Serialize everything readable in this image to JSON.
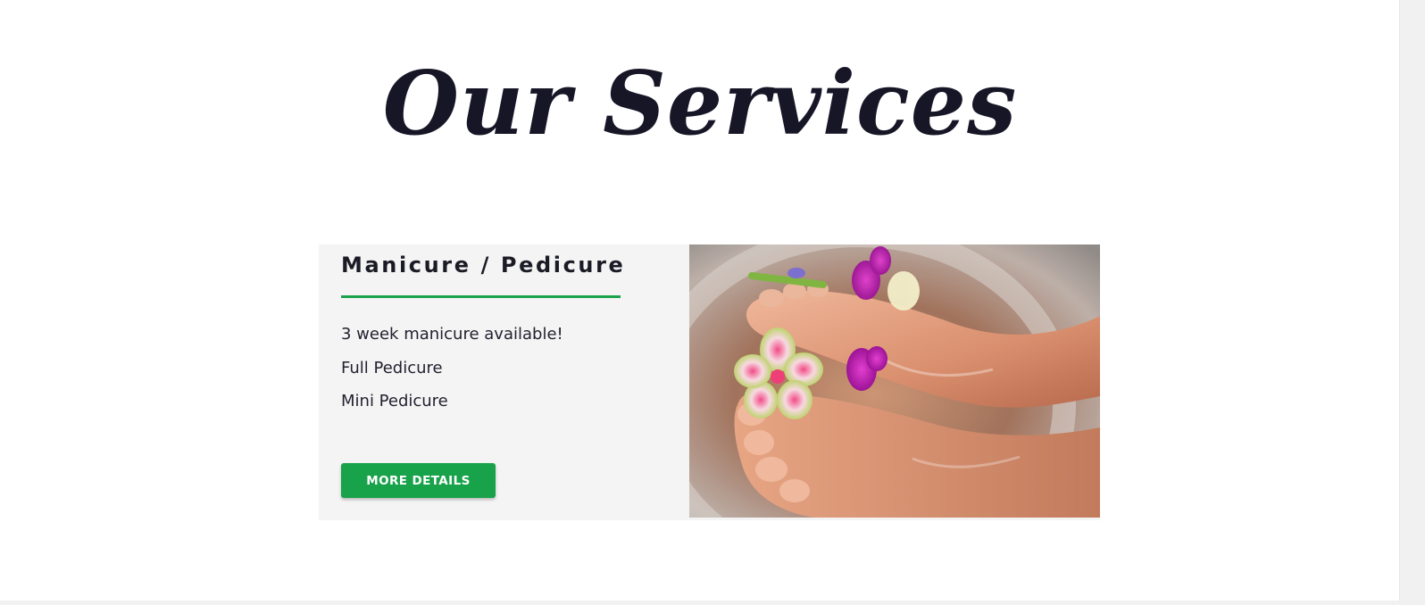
{
  "section": {
    "title": "Our Services"
  },
  "service_card": {
    "heading": "Manicure / Pedicure",
    "items": [
      "3 week manicure available!",
      "Full Pedicure",
      "Mini Pedicure"
    ],
    "button_label": "MORE DETAILS",
    "image_icon": "pedicure-photo"
  },
  "colors": {
    "accent": "#1aa34a",
    "title": "#171627",
    "card_background": "#f4f4f4"
  }
}
